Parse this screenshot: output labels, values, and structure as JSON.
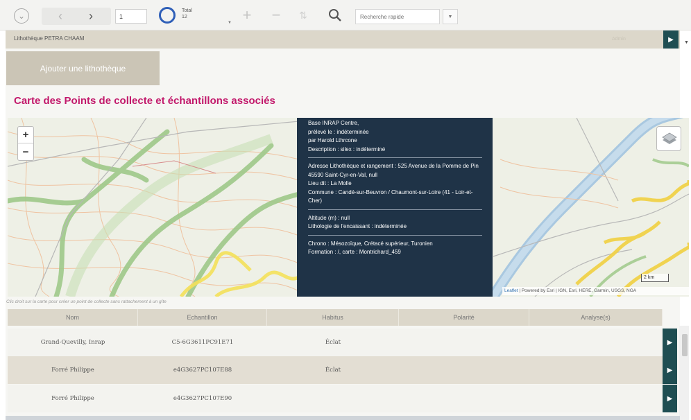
{
  "toolbar": {
    "page_value": "1",
    "total_label": "Total",
    "total_count": "12",
    "search_placeholder": "Recherche rapide",
    "icons": [
      "chevron-down-circle-icon",
      "chevron-left-icon",
      "chevron-right-icon",
      "spinner-ring-icon",
      "plus-icon",
      "minus-icon",
      "sort-icon",
      "search-icon",
      "dropdown-caret-icon"
    ]
  },
  "lithotheque": {
    "name": "Lithothèque PETRA CHAAM",
    "badge": "Admin",
    "add_button": "Ajouter une lithothèque"
  },
  "map_section": {
    "title": "Carte des Points de collecte et échantillons associés",
    "zoom_in": "+",
    "zoom_out": "−",
    "scale": "2 km",
    "attribution_leaflet": "Leaflet",
    "attribution_rest": " | Powered by Esri | IGN, Esri, HERE, Garmin, USGS, NGA",
    "hint": "Clic droit sur la carte pour créer un point de collecte sans rattachement à un gîte"
  },
  "popup": {
    "line1": "Base INRAP Centre,",
    "line2": "prélevé le : indéterminée",
    "line3": "par Harold Lthrcone",
    "line4": "Description : silex : indéterminé",
    "line5": "Adresse Lithothèque et rangement : 525 Avenue de la Pomme de Pin 45590 Saint-Cyr-en-Val, null",
    "line6": "Lieu dit : La Molle",
    "line7": "Commune : Candé-sur-Beuvron / Chaumont-sur-Loire (41 - Loir-et-Cher)",
    "line8": "Altitude (m) : null",
    "line9": "Lithologie de l'encaissant : indéterminée",
    "line10": "Chrono : Mésozoïque, Crétacé supérieur, Turonien",
    "line11": "Formation : /, carte : Montrichard_459"
  },
  "table": {
    "columns": [
      "Nom",
      "Echantillon",
      "Habitus",
      "Polarité",
      "Analyse(s)"
    ],
    "rows": [
      {
        "nom": "Grand-Quevilly, Inrap",
        "echantillon": "C5-6G3611PC91E71",
        "habitus": "Éclat",
        "polarite": "",
        "analyses": ""
      },
      {
        "nom": "Forré Philippe",
        "echantillon": "e4G3627PC107E88",
        "habitus": "Éclat",
        "polarite": "",
        "analyses": ""
      },
      {
        "nom": "Forré Philippe",
        "echantillon": "e4G3627PC107E90",
        "habitus": "",
        "polarite": "",
        "analyses": ""
      }
    ]
  },
  "colors": {
    "title_magenta": "#c2186b",
    "popup_bg": "#1f3347",
    "action_teal": "#1f4e52",
    "beige_header": "#dcd7ca",
    "ring_blue": "#2f5fb8"
  }
}
